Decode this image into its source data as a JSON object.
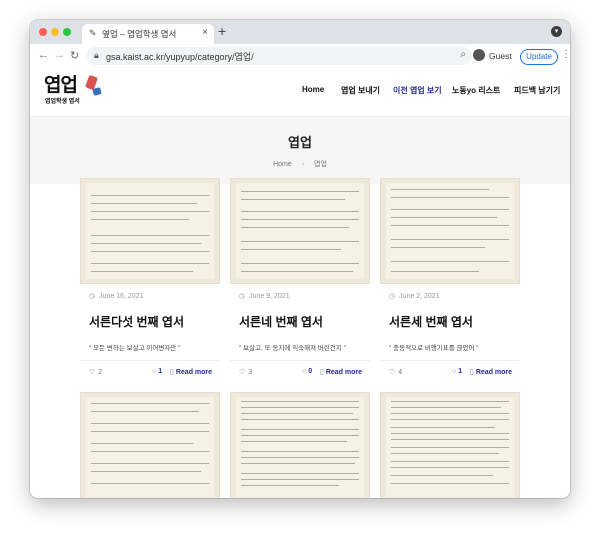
{
  "browser": {
    "tab_title": "옆업 – 엽업학생 엽서",
    "tab_close": "×",
    "new_tab": "+",
    "url": "gsa.kaist.ac.kr/yupyup/category/엽업/",
    "profile_label": "Guest",
    "update_label": "Update"
  },
  "site": {
    "logo_text": "엽업",
    "logo_sub": "엽업학생 엽서",
    "menu": [
      {
        "label": "Home"
      },
      {
        "label": "엽업 보내기"
      },
      {
        "label": "이전 엽업 보기"
      },
      {
        "label": "노동yo 리스트"
      },
      {
        "label": "피드백 남기기"
      }
    ]
  },
  "hero": {
    "title": "엽업",
    "breadcrumb_home": "Home",
    "breadcrumb_sep": "›",
    "breadcrumb_current": "엽업"
  },
  "posts": [
    {
      "date": "June 16, 2021",
      "title": "서른다섯 번째 엽서",
      "excerpt": "\" 모든 변하는 보살고 이어변자만 \"",
      "likes": "2",
      "comments": "1",
      "read_more": "Read more"
    },
    {
      "date": "June 9, 2021",
      "title": "서른네 번째 엽서",
      "excerpt": "\" 보살고, 또 동지에 익숙해져 버린건지 \"",
      "likes": "3",
      "comments": "0",
      "read_more": "Read more"
    },
    {
      "date": "June 2, 2021",
      "title": "서른세 번째 엽서",
      "excerpt": "\" 충동적으로 비행기표를 끊었어 \"",
      "likes": "4",
      "comments": "1",
      "read_more": "Read more"
    }
  ],
  "icons": {
    "back": "back-arrow-icon",
    "forward": "forward-arrow-icon",
    "reload": "reload-icon",
    "lock": "lock-icon",
    "search": "search-icon",
    "heart": "heart-icon",
    "comment": "comment-icon",
    "clock": "clock-icon"
  },
  "colors": {
    "accent": "#23299a",
    "hero_bg": "#f5f5f5",
    "postcard_bg": "#efe9dc"
  }
}
